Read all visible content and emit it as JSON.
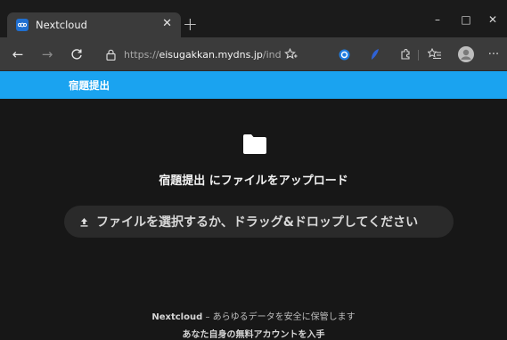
{
  "browser": {
    "tab_title": "Nextcloud",
    "tab_close_icon": "close-icon",
    "new_tab_label": "+",
    "window_controls": {
      "minimize": "–",
      "maximize": "□",
      "close": "✕"
    },
    "nav": {
      "back": "←",
      "forward": "→",
      "reload": "C"
    },
    "url_prefix": "https://",
    "url_host": "eisugakkan.mydns.jp",
    "url_path": "/index.p...",
    "more_label": "···"
  },
  "nextcloud": {
    "header_title": "宿題提出",
    "upload_heading": "宿題提出 にファイルをアップロード",
    "drop_zone_text": "ファイルを選択するか、ドラッグ&ドロップしてください",
    "footer_brand": "Nextcloud",
    "footer_tagline": " – あらゆるデータを安全に保管します",
    "footer_cta": "あなた自身の無料アカウントを入手"
  },
  "colors": {
    "header_blue": "#1aa3f0",
    "page_bg": "#171717"
  }
}
